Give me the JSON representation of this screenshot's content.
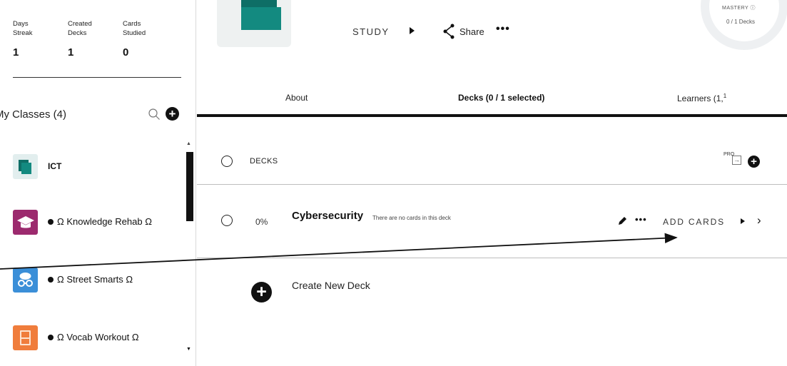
{
  "stats": [
    {
      "label": "Days\nStreak",
      "value": "1"
    },
    {
      "label": "Created\nDecks",
      "value": "1"
    },
    {
      "label": "Cards\nStudied",
      "value": "0"
    }
  ],
  "classes": {
    "title": "My Classes (4)",
    "items": [
      {
        "name": "ICT",
        "color": "#e2eeee",
        "icon": "cards-icon"
      },
      {
        "name": "Ω Knowledge Rehab Ω",
        "color": "#9c2a6e",
        "icon": "graduation-cap-icon"
      },
      {
        "name": "Ω Street Smarts Ω",
        "color": "#3b8fd8",
        "icon": "brain-glasses-icon"
      },
      {
        "name": "Ω Vocab Workout Ω",
        "color": "#f07d3c",
        "icon": "dictionary-icon"
      }
    ]
  },
  "header": {
    "study_label": "STUDY",
    "share_label": "Share",
    "more_label": "•••",
    "mastery_title": "MASTERY ⓘ",
    "mastery_sub": "0 / 1 Decks"
  },
  "tabs": [
    {
      "label": "About"
    },
    {
      "label": "Decks (0 / 1 selected)"
    },
    {
      "label": "Learners (1,"
    }
  ],
  "tab_learners_sup": "1",
  "decks_section": {
    "header_label": "DECKS",
    "pro_badge": "PRO",
    "deck": {
      "title": "Cybersecurity",
      "percent": "0%",
      "note": "There are no cards in this deck",
      "more_label": "•••",
      "add_cards_label": "ADD CARDS"
    },
    "create_label": "Create New Deck"
  },
  "colors": {
    "accent_teal": "#138a80",
    "dark": "#111111"
  }
}
